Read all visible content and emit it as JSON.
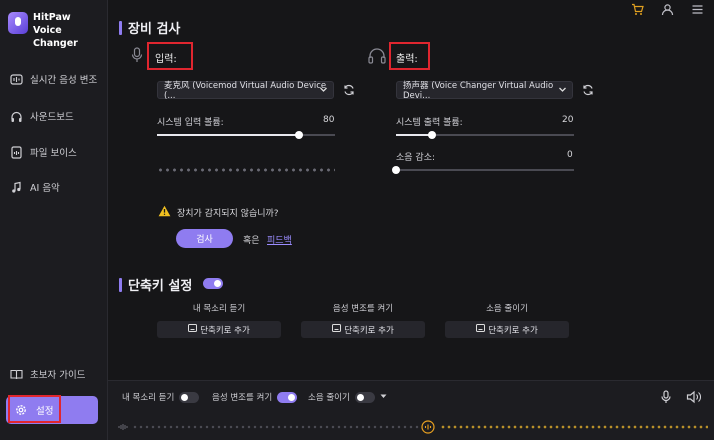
{
  "app": {
    "name_line1": "HitPaw",
    "name_line2": "Voice Changer"
  },
  "sidebar": {
    "items": [
      {
        "label": "실시간 음성 변조",
        "icon": "realtime-voice-icon"
      },
      {
        "label": "사운드보드",
        "icon": "headphones-icon"
      },
      {
        "label": "파일 보이스",
        "icon": "file-voice-icon"
      },
      {
        "label": "AI 음악",
        "icon": "music-note-icon"
      }
    ],
    "guide_label": "초보자 가이드",
    "settings_label": "설정"
  },
  "device_check": {
    "title": "장비 검사",
    "input_label": "입력:",
    "output_label": "출력:",
    "input_device": "麦克风 (Voicemod Virtual Audio Device (...",
    "output_device": "扬声器 (Voice Changer Virtual Audio Devi...",
    "input_volume_label": "시스템 입력 볼륨:",
    "input_volume_value": "80",
    "input_volume": 0.8,
    "output_volume_label": "시스템 출력 볼륨:",
    "output_volume_value": "20",
    "output_volume": 0.2,
    "noise_label": "소음 감소:",
    "noise_value": "0",
    "noise": 0,
    "warning_text": "장치가 감지되지 않습니까?",
    "check_button": "검사",
    "or_text": "혹은",
    "feedback_link": "피드백"
  },
  "hotkeys": {
    "title": "단축키 설정",
    "enabled": true,
    "columns": [
      {
        "label": "내 목소리 듣기",
        "button": "단축키로 추가"
      },
      {
        "label": "음성 변조를 켜기",
        "button": "단축키로 추가"
      },
      {
        "label": "소음 줄이기",
        "button": "단축키로 추가"
      }
    ]
  },
  "bottom": {
    "hear_myself": "내 목소리 듣기",
    "hear_myself_on": false,
    "voice_change": "음성 변조를 켜기",
    "voice_change_on": true,
    "noise_reduce": "소음 줄이기",
    "noise_reduce_on": false
  },
  "colors": {
    "accent": "#8f7cf0",
    "highlight": "#e0262f",
    "cart": "#e0a020"
  }
}
